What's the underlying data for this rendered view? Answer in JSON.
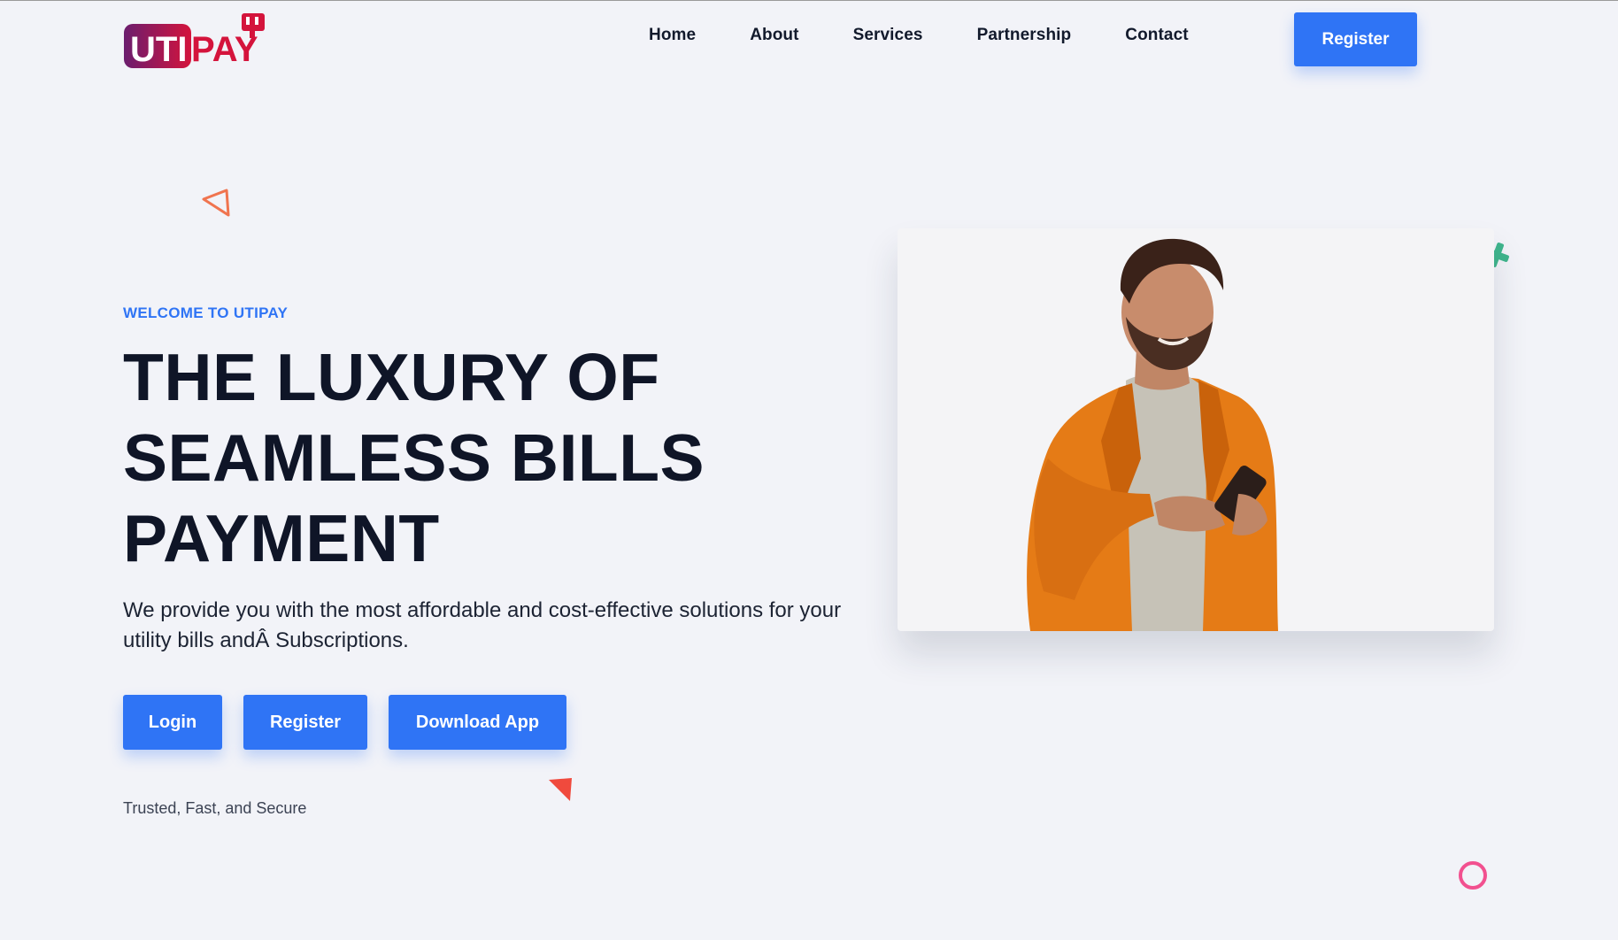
{
  "brand": {
    "logo_text_left": "UTI",
    "logo_text_right": "PAY",
    "logo_icon": "plug-icon"
  },
  "nav": {
    "items": [
      {
        "label": "Home"
      },
      {
        "label": "About"
      },
      {
        "label": "Services"
      },
      {
        "label": "Partnership"
      },
      {
        "label": "Contact"
      }
    ],
    "register_label": "Register"
  },
  "hero": {
    "eyebrow": "WELCOME TO UTIPAY",
    "headline_lines": [
      "THE LUXURY OF",
      "SEAMLESS BILLS",
      "PAYMENT"
    ],
    "description": "We provide you with the most affordable and cost-effective solutions for your utility bills andÂ Subscriptions.",
    "buttons": {
      "login": "Login",
      "register": "Register",
      "download": "Download App"
    },
    "tagline": "Trusted, Fast, and Secure"
  },
  "colors": {
    "accent": "#2f74f5",
    "heading": "#0f1527",
    "background": "#f2f3f8",
    "logo_gradient_start": "#6b1d6e",
    "logo_gradient_end": "#d4143c",
    "deco_orange": "#f0744f",
    "deco_green": "#3fb58c",
    "deco_red": "#f04a3d",
    "deco_pink": "#f2508f"
  },
  "decorations": [
    "outline-triangle-icon",
    "plus-cross-icon",
    "filled-triangle-icon",
    "ring-circle-icon"
  ]
}
